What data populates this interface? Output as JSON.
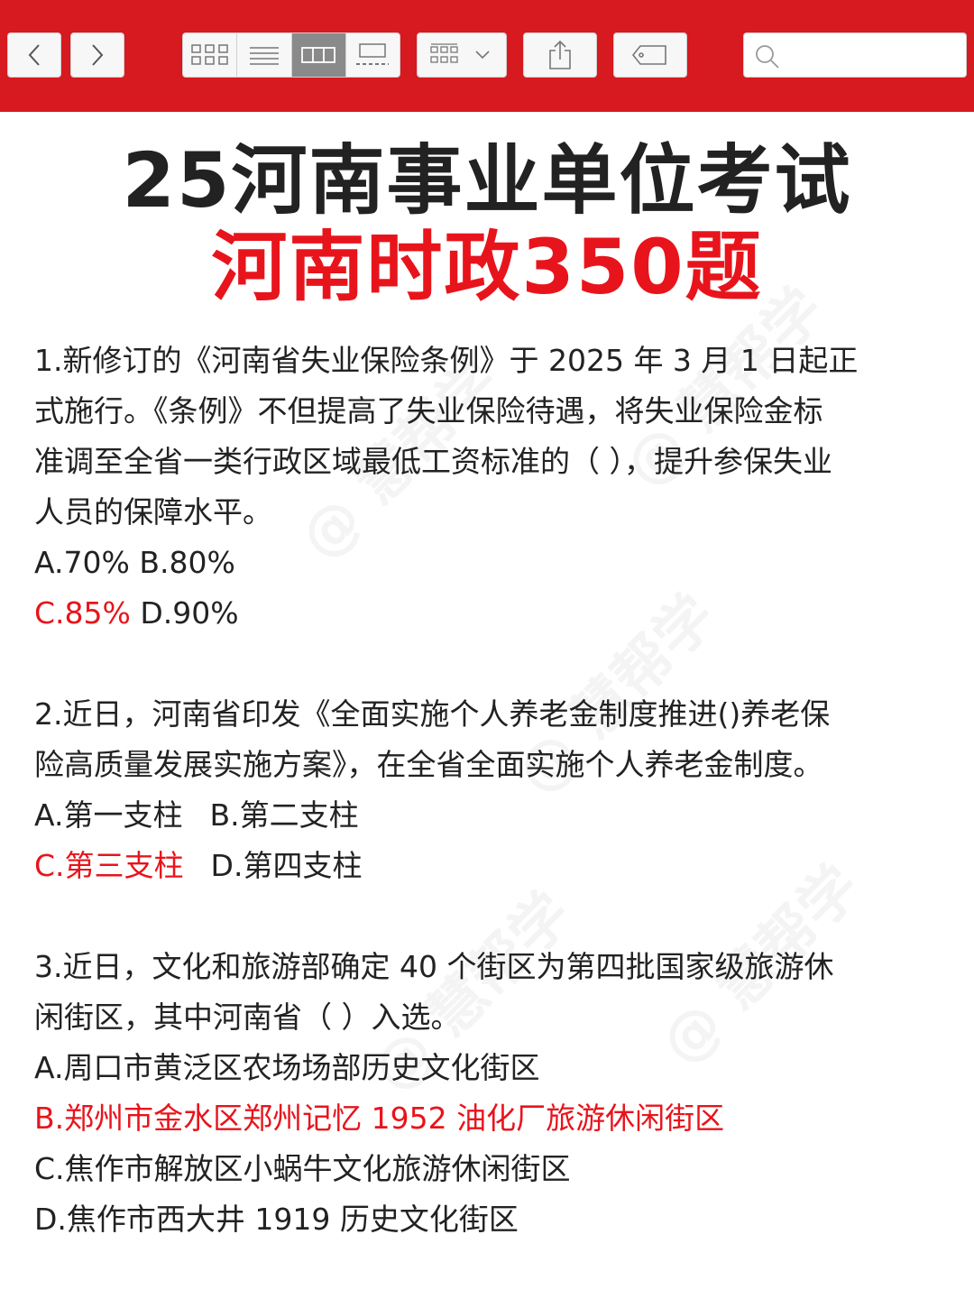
{
  "toolbar": {
    "back_icon": "chevron-left-icon",
    "forward_icon": "chevron-right-icon",
    "view_modes": [
      "grid-view-icon",
      "list-view-icon",
      "column-view-icon",
      "gallery-view-icon"
    ],
    "active_view_index": 2,
    "group_icon": "group-by-icon",
    "share_icon": "share-icon",
    "tag_icon": "tag-icon",
    "search_icon": "search-icon",
    "search_placeholder": "",
    "accent_color": "#d71920"
  },
  "title": {
    "line1": "25河南事业单位考试",
    "line2": "河南时政350题"
  },
  "watermark": "@ 慧帮学",
  "q1": {
    "lines": [
      "1.新修订的《河南省失业保险条例》于 2025 年 3 月 1 日起正",
      "式施行。《条例》不但提高了失业保险待遇，将失业保险金标",
      "准调至全省一类行政区域最低工资标准的（ ），提升参保失业",
      "人员的保障水平。"
    ],
    "options_row1": "A.70% B.80%",
    "option_c": "C.85%",
    "option_d": " D.90%"
  },
  "q2": {
    "lines": [
      "2.近日，河南省印发《全面实施个人养老金制度推进()养老保",
      "险高质量发展实施方案》，在全省全面实施个人养老金制度。"
    ],
    "option_a": "A.第一支柱",
    "option_b": "B.第二支柱",
    "option_c": "C.第三支柱",
    "option_d": "D.第四支柱"
  },
  "q3": {
    "lines": [
      "3.近日，文化和旅游部确定 40 个街区为第四批国家级旅游休",
      "闲街区，其中河南省（ ）入选。"
    ],
    "option_a": "A.周口市黄泛区农场场部历史文化街区",
    "option_b": "B.郑州市金水区郑州记忆 1952 油化厂旅游休闲街区",
    "option_c": "C.焦作市解放区小蜗牛文化旅游休闲街区",
    "option_d": "D.焦作市西大井 1919 历史文化街区"
  },
  "colors": {
    "title_red": "#e8141c",
    "answer_red": "#e8141c",
    "text": "#222222"
  }
}
